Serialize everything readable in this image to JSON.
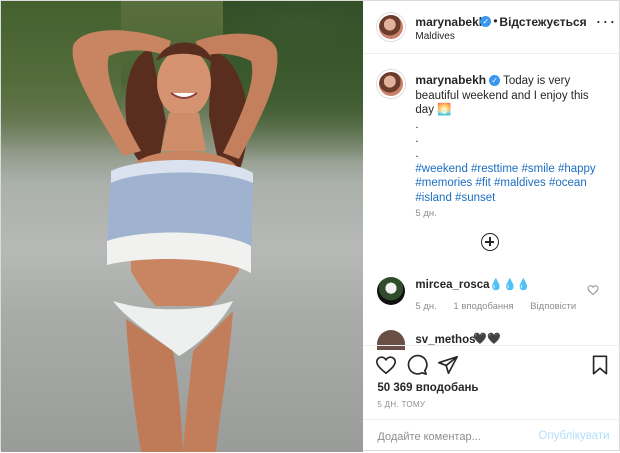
{
  "post": {
    "author": {
      "username": "marynabekh",
      "follow_status": "Відстежується",
      "location": "Maldives"
    },
    "caption": {
      "text": "Today is very beautiful weekend and I enjoy this day 🌅",
      "spacer_lines": ".\n.\n.",
      "hashtags": "#weekend #resttime #smile #happy #memories #fit #maldives #ocean #island #sunset",
      "ago": "5 дн."
    },
    "comments": [
      {
        "username": "mircea_rosca",
        "text": "💧💧💧",
        "ago": "5 дн.",
        "likes": "1 вподобання",
        "reply": "Відповісти"
      },
      {
        "username": "sv_methos",
        "text": "🖤🖤"
      }
    ],
    "likes_count": "50 369 вподобань",
    "posted_time": "5 ДН. ТОМУ",
    "add_comment": {
      "placeholder": "Додайте коментар...",
      "post_label": "Опублікувати"
    },
    "icons": {
      "verified": "verified-badge-icon",
      "more": "more-options-icon",
      "load_more": "plus-circle-icon",
      "like": "heart-icon",
      "comment": "comment-bubble-icon",
      "share": "paper-plane-icon",
      "save": "bookmark-icon"
    },
    "colors": {
      "link": "#1b6ec2",
      "verified": "#3897f0",
      "post_button": "#b2dffc"
    }
  }
}
